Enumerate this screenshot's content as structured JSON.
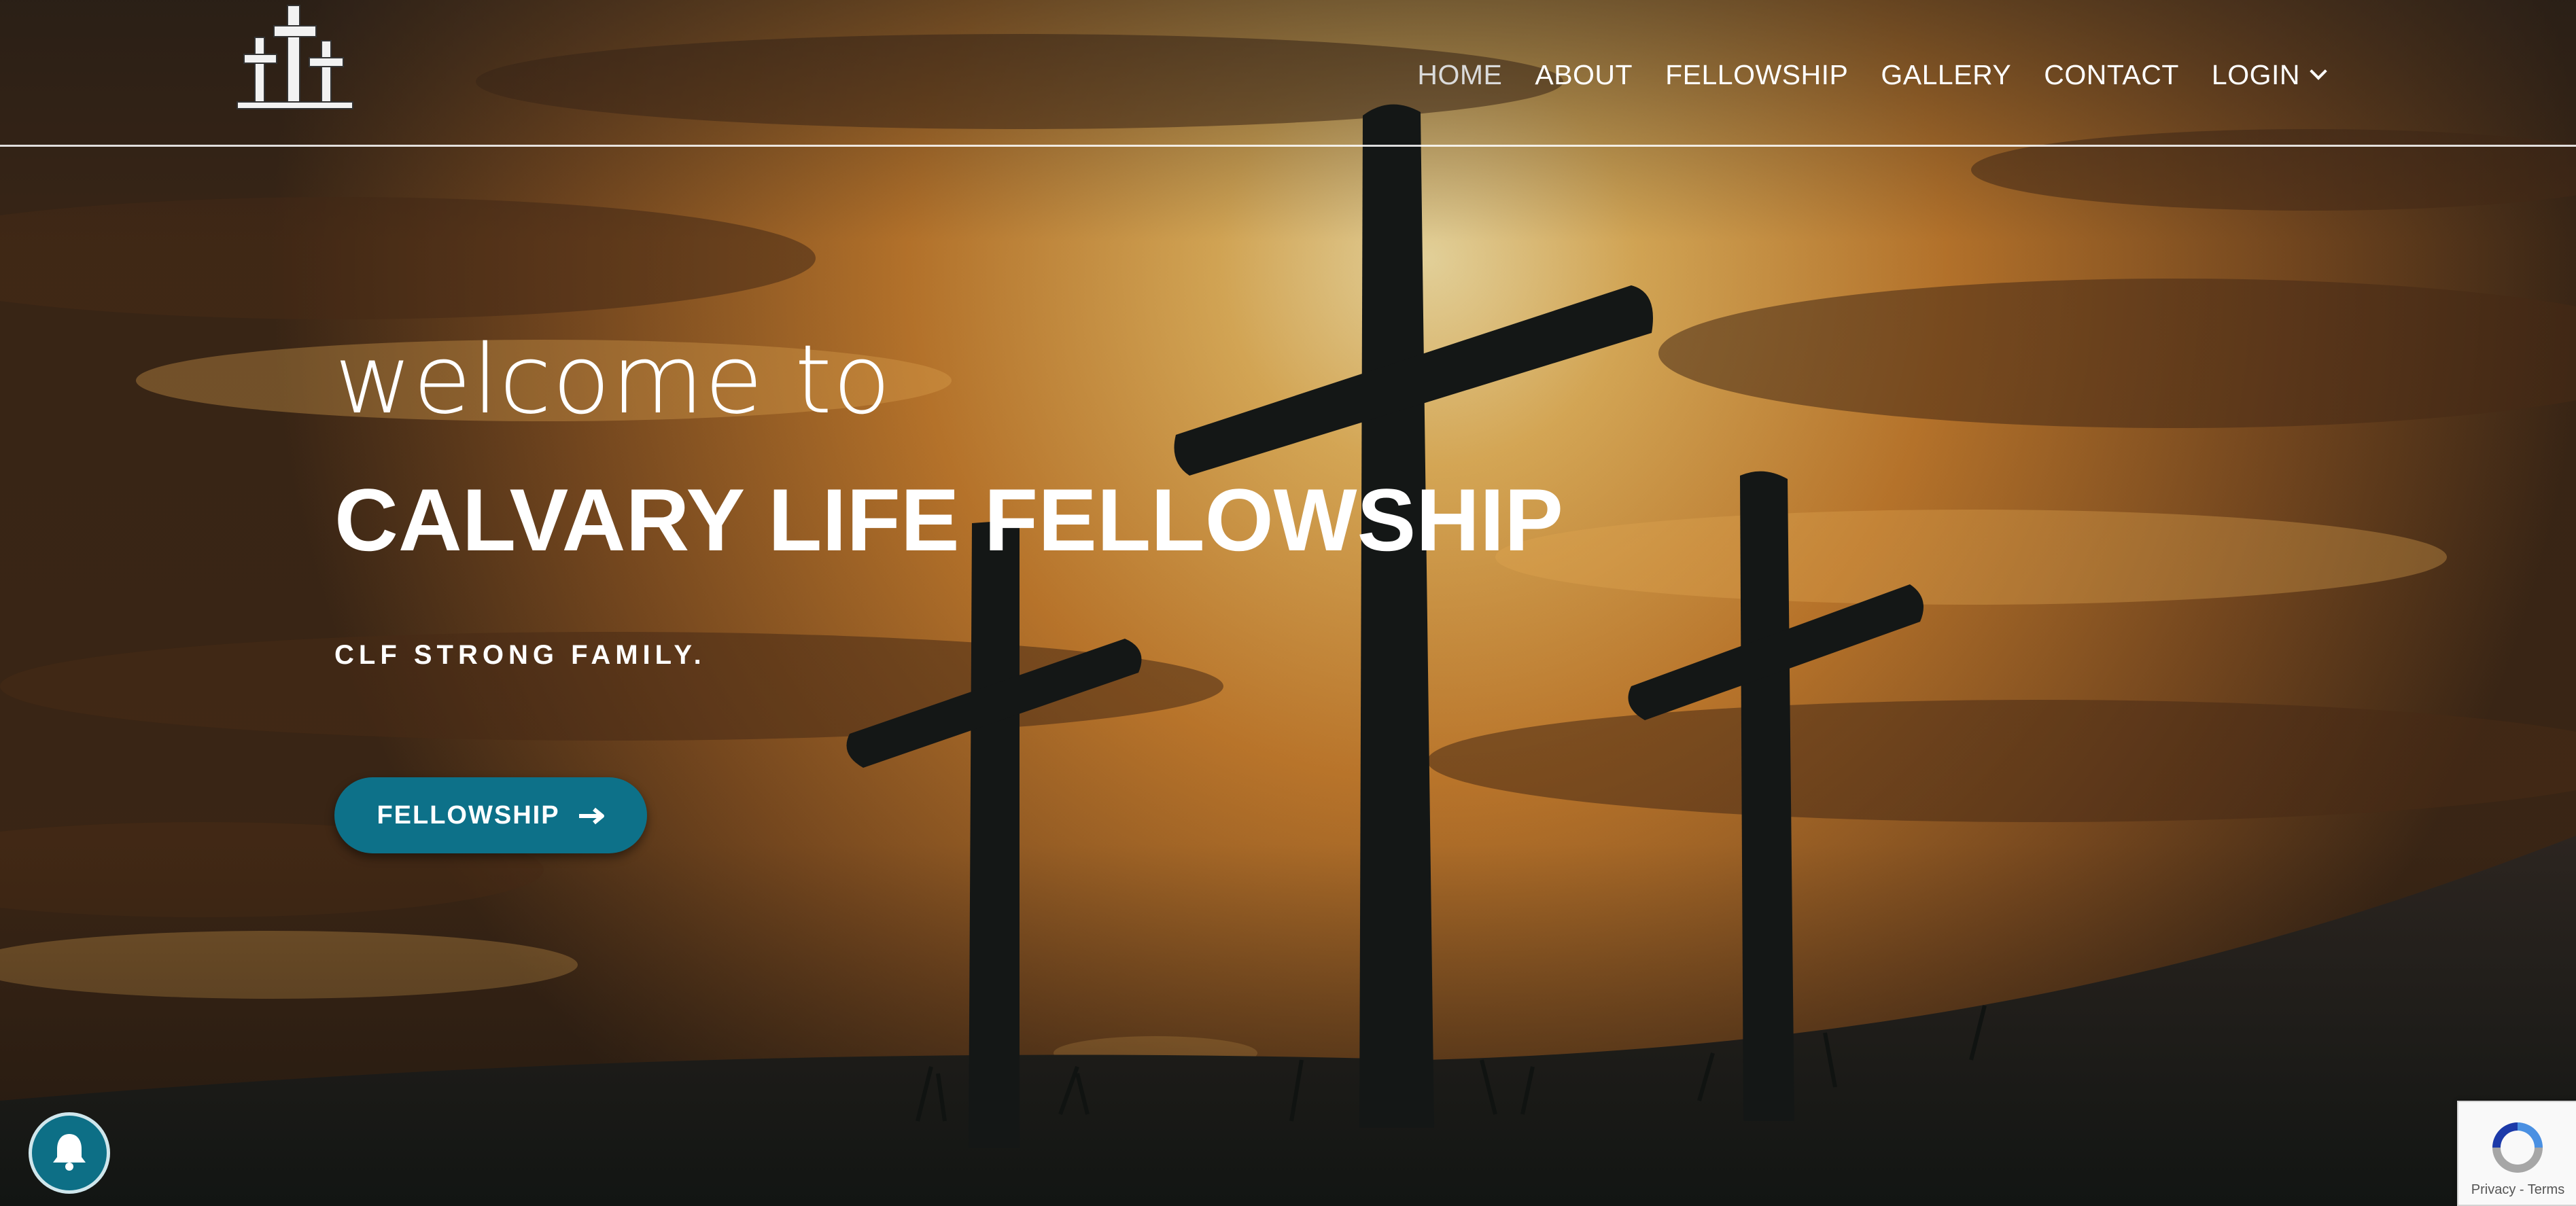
{
  "nav": {
    "items": [
      {
        "label": "HOME"
      },
      {
        "label": "ABOUT"
      },
      {
        "label": "FELLOWSHIP"
      },
      {
        "label": "GALLERY"
      },
      {
        "label": "CONTACT"
      },
      {
        "label": "LOGIN"
      }
    ],
    "active": "HOME"
  },
  "hero": {
    "welcome": "welcome to",
    "title": "CALVARY LIFE FELLOWSHIP",
    "tagline": "CLF STRONG FAMILY.",
    "cta_label": "FELLOWSHIP"
  },
  "recaptcha": {
    "privacy": "Privacy",
    "separator": " - ",
    "terms": "Terms"
  },
  "colors": {
    "accent": "#0d7189",
    "text": "#ffffff",
    "nav_active": "#dadada"
  },
  "icons": {
    "logo": "three-crosses-logo",
    "cta": "arrow-right-icon",
    "login": "chevron-down-icon",
    "notification": "bell-icon",
    "recaptcha": "recaptcha-icon"
  }
}
